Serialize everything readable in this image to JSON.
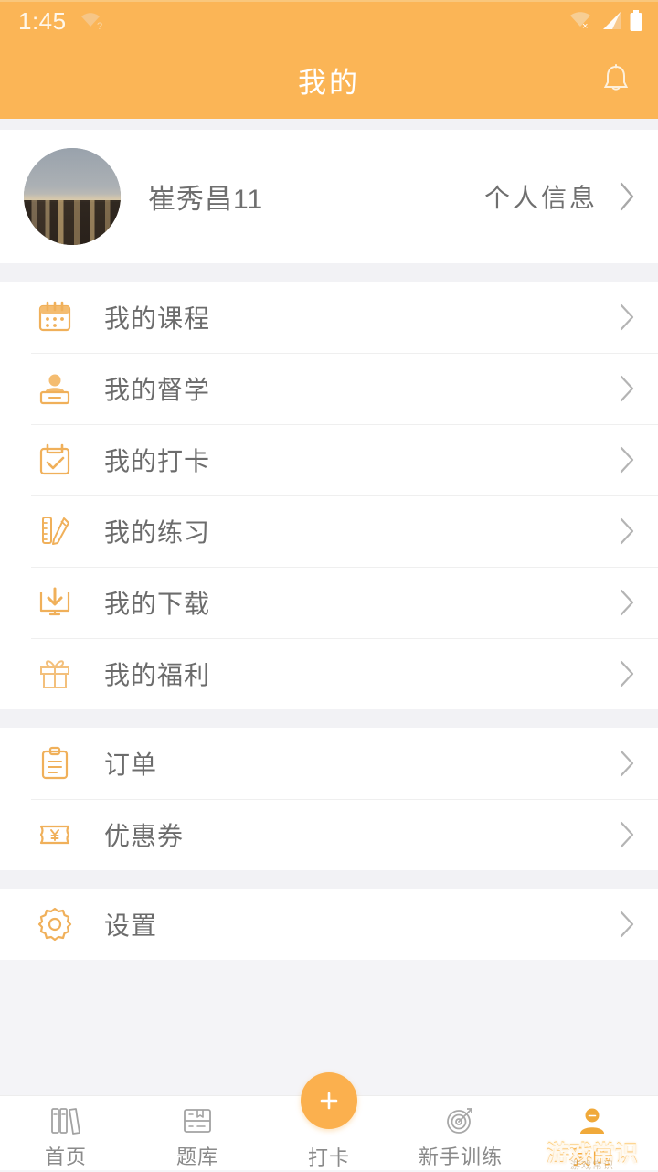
{
  "statusbar": {
    "time": "1:45",
    "wifi_question_icon": "wifi-question-icon",
    "wifi_off_icon": "wifi-disconnected-icon",
    "signal_icon": "cellular-signal-icon",
    "battery_icon": "battery-full-icon"
  },
  "header": {
    "title": "我的",
    "bell_icon": "notification-bell-icon",
    "bg_color": "#FBB556",
    "title_color": "#FFFFFF"
  },
  "profile": {
    "avatar_icon": "user-avatar-cityscape",
    "name": "崔秀昌11",
    "action_label": "个人信息",
    "chevron_icon": "chevron-right-icon"
  },
  "sections": [
    {
      "items": [
        {
          "label": "我的课程",
          "icon": "calendar-icon"
        },
        {
          "label": "我的督学",
          "icon": "tutor-person-icon"
        },
        {
          "label": "我的打卡",
          "icon": "check-calendar-icon"
        },
        {
          "label": "我的练习",
          "icon": "ruler-pencil-icon"
        },
        {
          "label": "我的下载",
          "icon": "download-monitor-icon"
        },
        {
          "label": "我的福利",
          "icon": "gift-icon"
        }
      ]
    },
    {
      "items": [
        {
          "label": "订单",
          "icon": "clipboard-order-icon"
        },
        {
          "label": "优惠券",
          "icon": "coupon-yen-icon"
        }
      ]
    },
    {
      "items": [
        {
          "label": "设置",
          "icon": "gear-settings-icon"
        }
      ]
    }
  ],
  "tabbar": {
    "items": [
      {
        "label": "首页",
        "icon": "books-home-icon",
        "active": false
      },
      {
        "label": "题库",
        "icon": "question-bank-book-icon",
        "active": false
      },
      {
        "label": "打卡",
        "icon": "plus-checkin-icon",
        "active": false,
        "is_center": true
      },
      {
        "label": "新手训练",
        "icon": "target-training-icon",
        "active": false
      },
      {
        "label": "我的",
        "icon": "user-profile-icon",
        "active": true
      }
    ],
    "active_color": "#F4A83A",
    "inactive_color": "#8A8A8A"
  },
  "watermark": {
    "text": "游戏常识",
    "subtext": "游戏常识"
  },
  "theme": {
    "accent": "#FBB556",
    "icon_orange": "#F0B05A",
    "text_gray": "#6C6C6C",
    "divider": "#EFEFEF",
    "page_bg": "#F2F2F5"
  }
}
